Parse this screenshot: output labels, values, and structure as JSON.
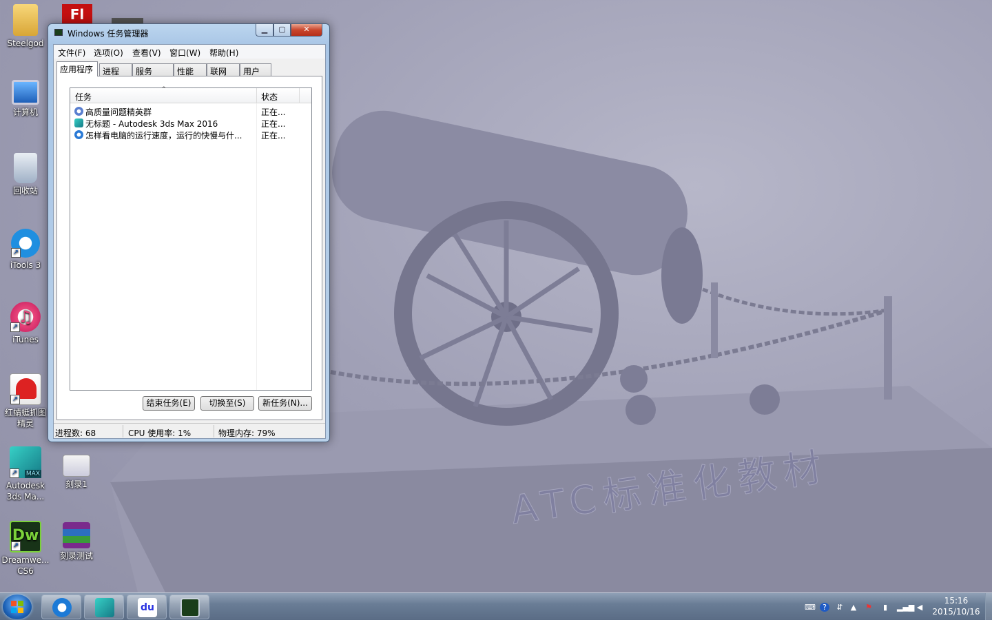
{
  "desktop": {
    "icons": [
      {
        "label": "Steelgod",
        "icon": "folder-icon"
      },
      {
        "label": "计算机",
        "icon": "computer-icon"
      },
      {
        "label": "回收站",
        "icon": "recycle-bin-icon"
      },
      {
        "label": "iTools 3",
        "icon": "itools-icon"
      },
      {
        "label": "iTunes",
        "icon": "itunes-icon"
      },
      {
        "label": "红蜻蜓抓图精灵",
        "icon": "screenshot-tool-icon"
      },
      {
        "label": "Autodesk 3ds Ma...",
        "icon": "3dsmax-icon",
        "badge": "MAX"
      },
      {
        "label": "刻录1",
        "icon": "burn-icon"
      },
      {
        "label": "Dreamwe... CS6",
        "icon": "dreamweaver-icon",
        "badge": "Dw"
      },
      {
        "label": "刻录测试",
        "icon": "winrar-icon"
      }
    ],
    "wallpaper_text": "ATC标准化教材"
  },
  "task_manager": {
    "title": "Windows 任务管理器",
    "menu": [
      "文件(F)",
      "选项(O)",
      "查看(V)",
      "窗口(W)",
      "帮助(H)"
    ],
    "tabs": [
      "应用程序",
      "进程",
      "服务",
      "性能",
      "联网",
      "用户"
    ],
    "active_tab": "应用程序",
    "columns": {
      "task": "任务",
      "status": "状态"
    },
    "rows": [
      {
        "name": "高质量问题精英群",
        "status": "正在...",
        "icon": "qq-group-icon"
      },
      {
        "name": "无标题 - Autodesk 3ds Max 2016",
        "status": "正在...",
        "icon": "3dsmax-icon"
      },
      {
        "name": "怎样看电脑的运行速度，运行的快慢与什...",
        "status": "正在...",
        "icon": "browser-icon"
      }
    ],
    "buttons": {
      "end_task": "结束任务(E)",
      "switch_to": "切换至(S)",
      "new_task": "新任务(N)..."
    },
    "status_bar": {
      "processes": "进程数: 68",
      "cpu": "CPU 使用率: 1%",
      "memory": "物理内存: 79%"
    }
  },
  "taskbar": {
    "apps": [
      "sogou-browser-icon",
      "3dsmax-icon",
      "baidu-icon",
      "task-manager-icon"
    ],
    "clock": {
      "time": "15:16",
      "date": "2015/10/16"
    }
  },
  "colors": {
    "accent": "#1e63b8",
    "close_button": "#c9462c",
    "wallpaper": "#a0a0b6"
  }
}
